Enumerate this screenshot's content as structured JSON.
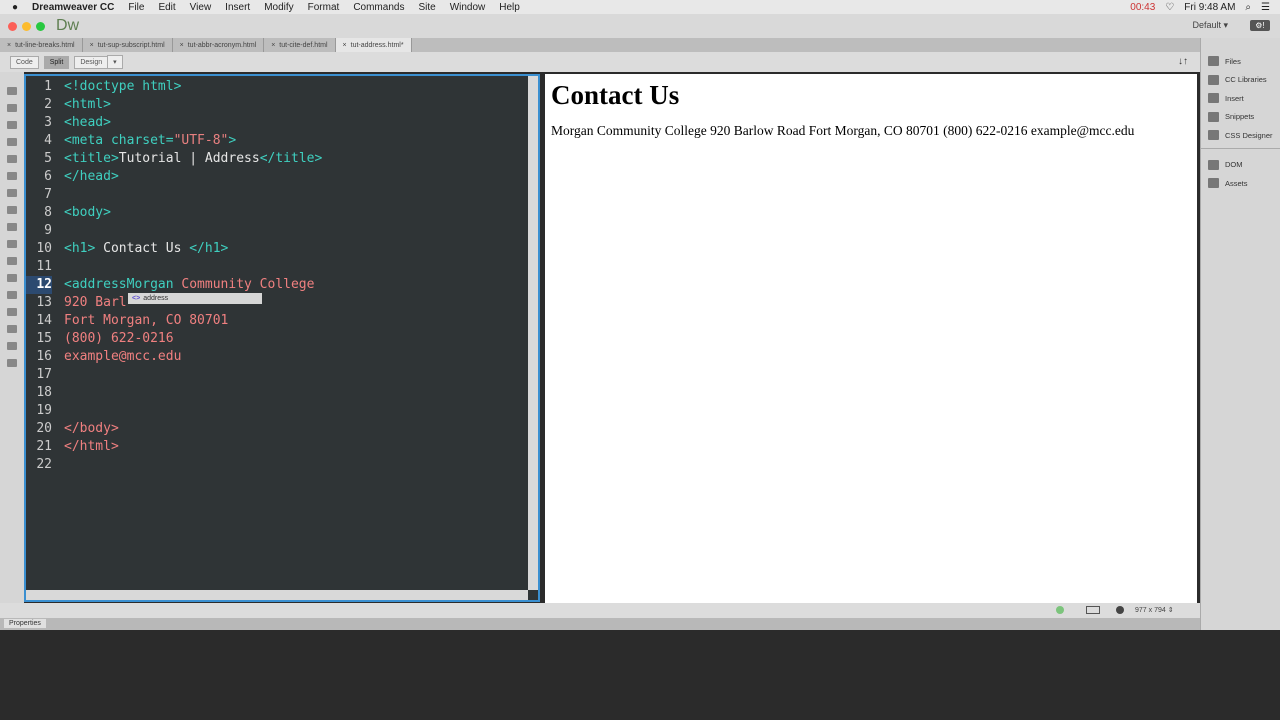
{
  "menubar": {
    "app": "Dreamweaver CC",
    "items": [
      "File",
      "Edit",
      "View",
      "Insert",
      "Modify",
      "Format",
      "Commands",
      "Site",
      "Window",
      "Help"
    ],
    "recording_time": "00:43",
    "clock": "Fri 9:48 AM"
  },
  "window": {
    "logo": "Dw",
    "workspace": "Default ▾"
  },
  "tabs": [
    {
      "label": "tut-line-breaks.html"
    },
    {
      "label": "tut-sup-subscript.html"
    },
    {
      "label": "tut-abbr-acronym.html"
    },
    {
      "label": "tut-cite-def.html"
    },
    {
      "label": "tut-address.html*",
      "active": true
    }
  ],
  "view_buttons": {
    "code": "Code",
    "split": "Split",
    "design": "Design"
  },
  "code": {
    "current_line": 12,
    "lines": [
      [
        [
          "t",
          "<!doctype html>"
        ]
      ],
      [
        [
          "t",
          "<html>"
        ]
      ],
      [
        [
          "t",
          "<head>"
        ]
      ],
      [
        [
          "t",
          "<meta charset="
        ],
        [
          "s",
          "\"UTF-8\""
        ],
        [
          "t",
          ">"
        ]
      ],
      [
        [
          "t",
          "<title>"
        ],
        [
          "x",
          "Tutorial | Address"
        ],
        [
          "t",
          "</title>"
        ]
      ],
      [
        [
          "t",
          "</head>"
        ]
      ],
      [],
      [
        [
          "t",
          "<body>"
        ]
      ],
      [],
      [
        [
          "t",
          "<h1>"
        ],
        [
          "x",
          " Contact Us "
        ],
        [
          "t",
          "</h1>"
        ]
      ],
      [],
      [
        [
          "t",
          "<addressMorgan"
        ],
        [
          "p",
          " Community College"
        ]
      ],
      [
        [
          "p",
          "920 Barl"
        ]
      ],
      [
        [
          "p",
          "Fort Morgan, CO 80701"
        ]
      ],
      [
        [
          "p",
          "(800) 622-0216"
        ]
      ],
      [
        [
          "p",
          "example@mcc.edu"
        ]
      ],
      [],
      [],
      [],
      [
        [
          "p",
          "</body>"
        ]
      ],
      [
        [
          "p",
          "</html>"
        ]
      ],
      []
    ]
  },
  "code_hint": {
    "icon": "tag-icon",
    "label": "address"
  },
  "design": {
    "heading": "Contact Us",
    "paragraph": "Morgan Community College 920 Barlow Road Fort Morgan, CO 80701 (800) 622-0216 example@mcc.edu"
  },
  "statusbar": {
    "window_size": "977 x 794 ⇕"
  },
  "properties": {
    "label": "Properties"
  },
  "panels": {
    "group1": [
      {
        "label": "Files",
        "icon": "files-icon"
      },
      {
        "label": "CC Libraries",
        "icon": "cc-libraries-icon"
      },
      {
        "label": "Insert",
        "icon": "insert-icon"
      },
      {
        "label": "Snippets",
        "icon": "snippets-icon"
      },
      {
        "label": "CSS Designer",
        "icon": "css-designer-icon"
      }
    ],
    "group2": [
      {
        "label": "DOM",
        "icon": "dom-icon"
      },
      {
        "label": "Assets",
        "icon": "assets-icon"
      }
    ]
  }
}
